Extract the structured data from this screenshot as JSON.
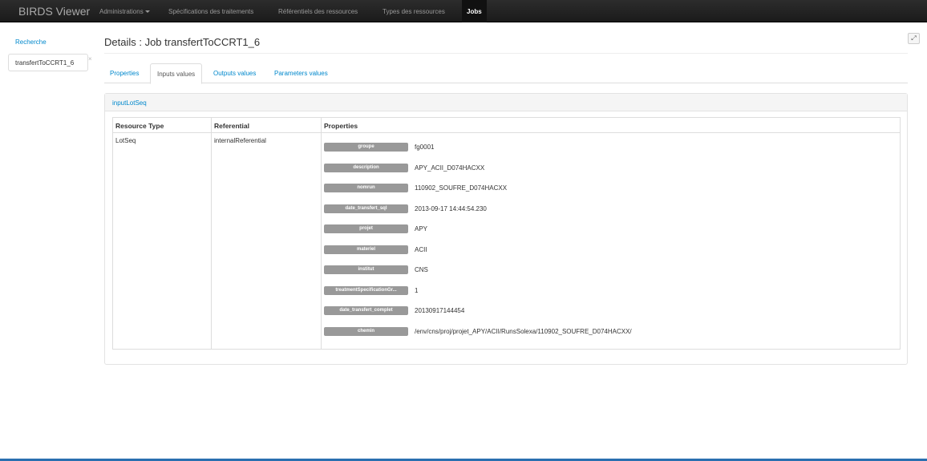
{
  "navbar": {
    "brand": "BIRDS Viewer",
    "items": [
      {
        "label": "Administrations"
      },
      {
        "label": "Spécifications des traitements"
      },
      {
        "label": "Référentiels des ressources"
      },
      {
        "label": "Types des ressources"
      },
      {
        "label": "Jobs"
      }
    ]
  },
  "sidebar": {
    "search_link": "Recherche",
    "open_tab": "transfertToCCRT1_6",
    "close_symbol": "×"
  },
  "header": {
    "title": "Details : Job transfertToCCRT1_6"
  },
  "tabs": [
    {
      "label": "Properties"
    },
    {
      "label": "Inputs values"
    },
    {
      "label": "Outputs values"
    },
    {
      "label": "Parameters values"
    }
  ],
  "panel": {
    "title": "inputLotSeq",
    "table": {
      "headers": [
        "Resource Type",
        "Referential",
        "Properties"
      ],
      "resource_type": "LotSeq",
      "referential": "internalReferential",
      "properties": [
        {
          "key": "groupe",
          "value": "fg0001"
        },
        {
          "key": "description",
          "value": "APY_ACII_D074HACXX"
        },
        {
          "key": "nomrun",
          "value": "110902_SOUFRE_D074HACXX"
        },
        {
          "key": "date_transfert_sql",
          "value": "2013-09-17 14:44:54.230"
        },
        {
          "key": "projet",
          "value": "APY"
        },
        {
          "key": "materiel",
          "value": "ACII"
        },
        {
          "key": "institut",
          "value": "CNS"
        },
        {
          "key": "treatmentSpecificationGr...",
          "value": "1"
        },
        {
          "key": "date_transfert_complet",
          "value": "20130917144454"
        },
        {
          "key": "chemin",
          "value": "/env/cns/proj/projet_APY/ACII/RunsSolexa/110902_SOUFRE_D074HACXX/"
        }
      ]
    }
  }
}
